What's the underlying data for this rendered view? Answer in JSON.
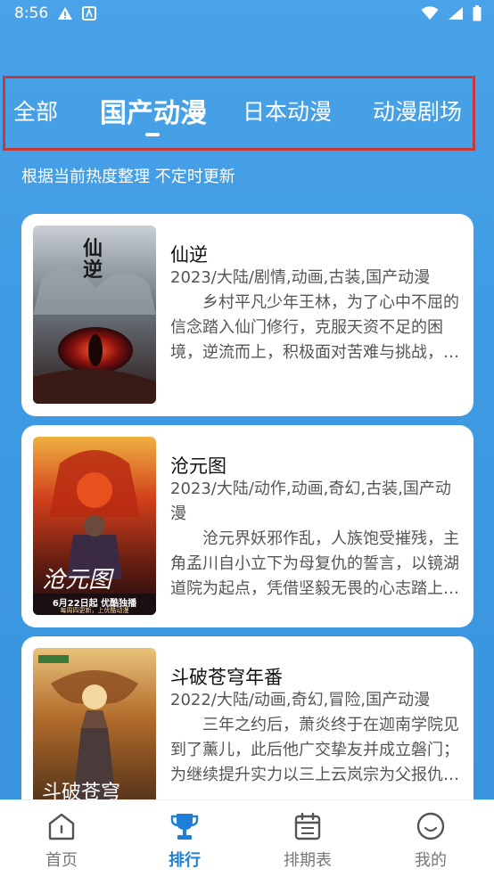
{
  "status_bar": {
    "time": "8:56"
  },
  "tabs": [
    {
      "label": "全部",
      "active": false
    },
    {
      "label": "国产动漫",
      "active": true
    },
    {
      "label": "日本动漫",
      "active": false
    },
    {
      "label": "动漫剧场",
      "active": false
    }
  ],
  "subtitle": "根据当前热度整理 不定时更新",
  "cards": [
    {
      "title": "仙逆",
      "meta": "2023/大陆/剧情,动画,古装,国产动漫",
      "desc": "乡村平凡少年王林，为了心中不屈的信念踏入仙门修行，克服天资不足的困境，逆流而上，积极面对苦难与挑战，最终成就一番事业。",
      "poster_text": "仙逆"
    },
    {
      "title": "沧元图",
      "meta": "2023/大陆/动作,动画,奇幻,古装,国产动漫",
      "desc": "沧元界妖邪作乱，人族饱受摧残，主角孟川自小立下为母复仇的誓言，以镜湖道院为起点，凭借坚毅无畏的心志踏上修行之路。",
      "poster_text": "沧元图",
      "poster_caption": "6月22日起 优酷独播",
      "poster_subcaption": "每周四更新，上优酷动漫"
    },
    {
      "title": "斗破苍穹年番",
      "meta": "2022/大陆/动画,奇幻,冒险,国产动漫",
      "desc": "三年之约后，萧炎终于在迦南学院见到了薰儿，此后他广交挚友并成立磐门；为继续提升实力以三上云岚宗为父报仇，踏上新的征程。",
      "poster_text": "斗破苍穹"
    }
  ],
  "bottom_nav": [
    {
      "label": "首页",
      "icon": "home-icon",
      "active": false
    },
    {
      "label": "排行",
      "icon": "trophy-icon",
      "active": true
    },
    {
      "label": "排期表",
      "icon": "calendar-icon",
      "active": false
    },
    {
      "label": "我的",
      "icon": "smiley-icon",
      "active": false
    }
  ],
  "colors": {
    "accent": "#1d7fd8",
    "background_top": "#4aa3e8",
    "tab_frame": "#c43a3a"
  }
}
